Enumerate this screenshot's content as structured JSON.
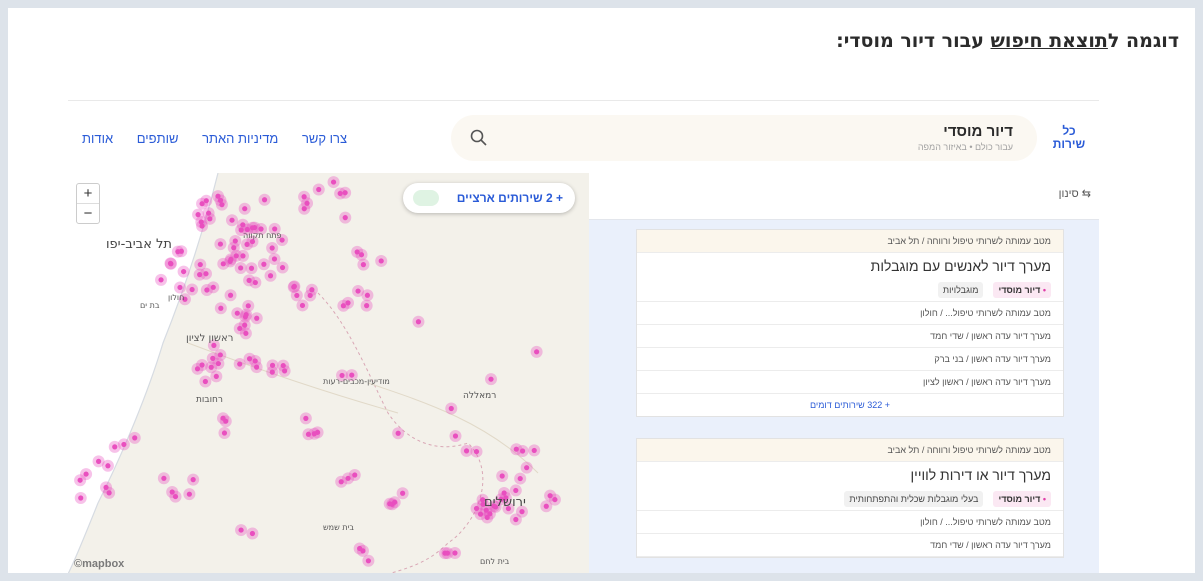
{
  "heading": {
    "before": "דוגמה ל",
    "link": "תוצאת חיפוש",
    "after": " עבור דיור מוסדי:"
  },
  "topbar": {
    "all_services": "כל שירות",
    "search_title": "דיור מוסדי",
    "search_sub": "עבור כולם • באיזור המפה",
    "nav": [
      "צרו קשר",
      "מדיניות האתר",
      "שותפים",
      "אודות"
    ]
  },
  "map": {
    "national_services": "+ 2 שירותים ארציים",
    "zoom_in": "+",
    "zoom_out": "−",
    "attribution": "©mapbox",
    "labels": {
      "tel_aviv": "תל אביב-יפו",
      "jerusalem": "ירושלים",
      "rishon": "ראשון לציון",
      "ramla": "רמאללה",
      "modiin": "מודיעין-מכבים-רעות",
      "petah_tikva": "פתח תקווה",
      "rehovot": "רחובות",
      "holon": "חולון",
      "bat_yam": "בת ים",
      "bet_shemesh": "בית שמש",
      "bet_lehem": "בית לחם"
    },
    "dot_color": "#e94fbf"
  },
  "list": {
    "filter_label": "סינון",
    "cards": [
      {
        "head": "מטב עמותה לשרותי טיפול ורווחה / תל אביב",
        "title": "מערך דיור לאנשים עם מוגבלות",
        "tag_primary": "דיור מוסדי",
        "tag_secondary": "מוגבלויות",
        "rows": [
          "מטב עמותה לשרותי טיפול... / חולון",
          "מערך דיור עדה ראשון / שדי חמד",
          "מערך דיור עדה ראשון / בני ברק",
          "מערך דיור עדה ראשון / ראשון לציון"
        ],
        "more": "+ 322 שירותים דומים"
      },
      {
        "head": "מטב עמותה לשרותי טיפול ורווחה / תל אביב",
        "title": "מערך דיור או דירות לוויין",
        "tag_primary": "דיור מוסדי",
        "tag_secondary": "בעלי מוגבלות שכלית והתפתחותית",
        "rows": [
          "מטב עמותה לשרותי טיפול... / חולון",
          "מערך דיור עדה ראשון / שדי חמד"
        ]
      }
    ]
  }
}
